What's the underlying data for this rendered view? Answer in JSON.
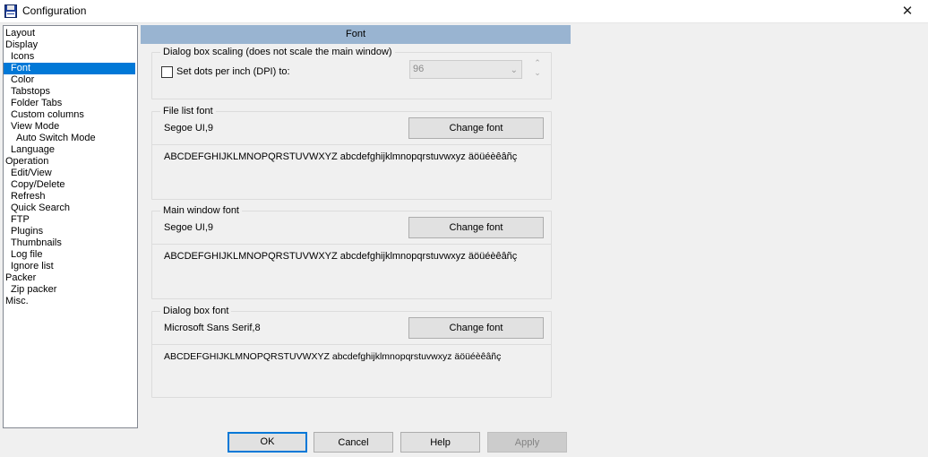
{
  "window": {
    "title": "Configuration",
    "close_glyph": "✕",
    "app_icon": "floppy-disk-icon"
  },
  "tree": {
    "items": [
      {
        "label": "Layout",
        "level": 0
      },
      {
        "label": "Display",
        "level": 0
      },
      {
        "label": "Icons",
        "level": 1
      },
      {
        "label": "Font",
        "level": 1,
        "selected": true
      },
      {
        "label": "Color",
        "level": 1
      },
      {
        "label": "Tabstops",
        "level": 1
      },
      {
        "label": "Folder Tabs",
        "level": 1
      },
      {
        "label": "Custom columns",
        "level": 1
      },
      {
        "label": "View Mode",
        "level": 1
      },
      {
        "label": "Auto Switch Mode",
        "level": 2
      },
      {
        "label": "Language",
        "level": 1
      },
      {
        "label": "Operation",
        "level": 0
      },
      {
        "label": "Edit/View",
        "level": 1
      },
      {
        "label": "Copy/Delete",
        "level": 1
      },
      {
        "label": "Refresh",
        "level": 1
      },
      {
        "label": "Quick Search",
        "level": 1
      },
      {
        "label": "FTP",
        "level": 1
      },
      {
        "label": "Plugins",
        "level": 1
      },
      {
        "label": "Thumbnails",
        "level": 1
      },
      {
        "label": "Log file",
        "level": 1
      },
      {
        "label": "Ignore list",
        "level": 1
      },
      {
        "label": "Packer",
        "level": 0
      },
      {
        "label": "Zip packer",
        "level": 1
      },
      {
        "label": "Misc.",
        "level": 0
      }
    ]
  },
  "panel": {
    "header": "Font",
    "scaling": {
      "title": "Dialog box scaling (does not scale the main window)",
      "checkbox_label": "Set dots per inch (DPI) to:",
      "checked": false,
      "dpi_value": "96"
    },
    "file_list": {
      "title": "File list font",
      "font": "Segoe UI,9",
      "button": "Change font",
      "sample": "ABCDEFGHIJKLMNOPQRSTUVWXYZ abcdefghijklmnopqrstuvwxyz äöüéèêâñç"
    },
    "main_window": {
      "title": "Main window font",
      "font": "Segoe UI,9",
      "button": "Change font",
      "sample": "ABCDEFGHIJKLMNOPQRSTUVWXYZ abcdefghijklmnopqrstuvwxyz äöüéèêâñç"
    },
    "dialog_box": {
      "title": "Dialog box font",
      "font": "Microsoft Sans Serif,8",
      "button": "Change font",
      "sample": "ABCDEFGHIJKLMNOPQRSTUVWXYZ abcdefghijklmnopqrstuvwxyz äöüéèêâñç"
    }
  },
  "buttons": {
    "ok": "OK",
    "cancel": "Cancel",
    "help": "Help",
    "apply": "Apply"
  },
  "colors": {
    "accent": "#0078d7",
    "header_bg": "#99b4d1"
  }
}
